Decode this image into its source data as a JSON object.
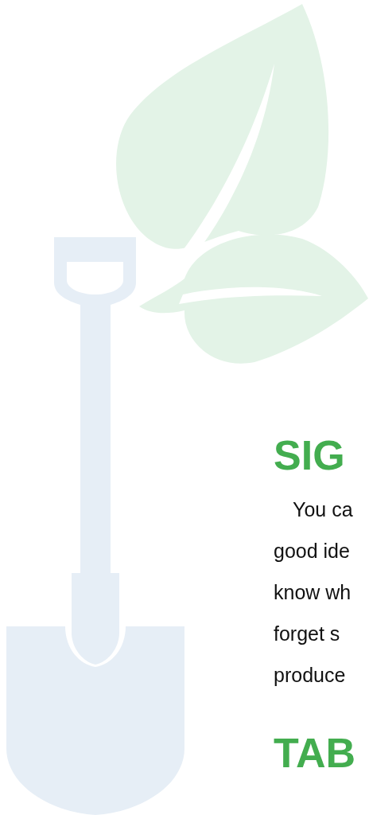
{
  "sections": [
    {
      "heading": "SIG",
      "lines": [
        "You ca",
        "good ide",
        "know wh",
        "forget s",
        "produce"
      ]
    },
    {
      "heading": "TAB"
    }
  ]
}
